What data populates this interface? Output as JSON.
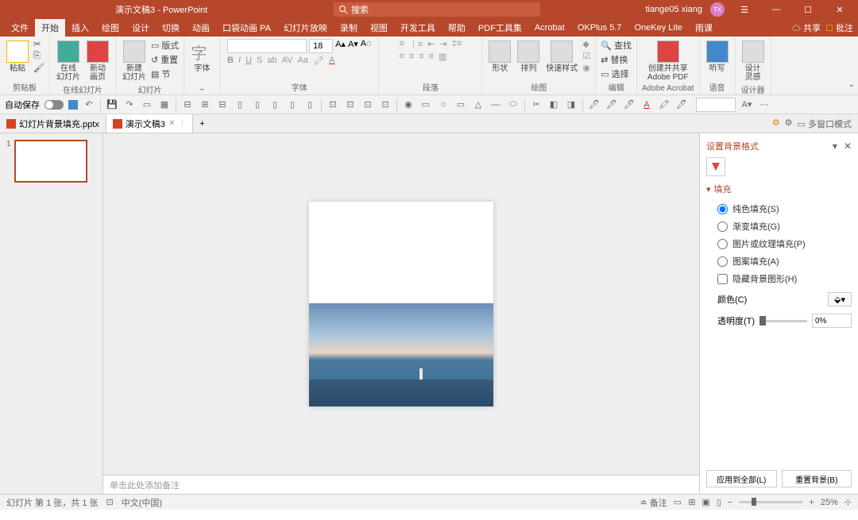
{
  "title": {
    "doc": "演示文稿3 - PowerPoint",
    "search": "搜索",
    "user": "tiange05 xiang",
    "avatar": "TX"
  },
  "menu": {
    "items": [
      "文件",
      "开始",
      "插入",
      "绘图",
      "设计",
      "切换",
      "动画",
      "口袋动画 PA",
      "幻灯片放映",
      "录制",
      "视图",
      "开发工具",
      "帮助",
      "PDF工具集",
      "Acrobat",
      "OKPlus 5.7",
      "OneKey Lite",
      "雨课"
    ],
    "active": 1,
    "share": "共享",
    "comment": "批注"
  },
  "ribbon": {
    "g1": {
      "paste": "粘贴",
      "label": "剪贴板"
    },
    "g2": {
      "online": "在线\n幻灯片",
      "newpage": "新动\n画页",
      "label": "在线幻灯片"
    },
    "g3": {
      "newslide": "新建\n幻灯片",
      "layout": "版式",
      "reset": "重置",
      "section": "节",
      "label": "幻灯片"
    },
    "g4": {
      "font": "字体",
      "label": "字体",
      "fontsize": "18"
    },
    "g5": {
      "label": "段落"
    },
    "g6": {
      "shape": "形状",
      "arrange": "排列",
      "quick": "快速样式",
      "label": "绘图"
    },
    "g7": {
      "find": "查找",
      "replace": "替换",
      "select": "选择",
      "label": "编辑"
    },
    "g8": {
      "adobe": "创建并共享\nAdobe PDF",
      "label": "Adobe Acrobat"
    },
    "g9": {
      "dict": "听写",
      "label": "语音"
    },
    "g10": {
      "design": "设计\n灵感",
      "label": "设计器"
    }
  },
  "qat": {
    "autosave": "自动保存"
  },
  "doctabs": {
    "t1": "幻灯片背景填充.pptx",
    "t2": "演示文稿3",
    "multi": "多窗口模式"
  },
  "thumb": {
    "num": "1"
  },
  "notes": "单击此处添加备注",
  "pane": {
    "title": "设置背景格式",
    "section": "填充",
    "o1": "纯色填充(S)",
    "o2": "渐变填充(G)",
    "o3": "图片或纹理填充(P)",
    "o4": "图案填充(A)",
    "o5": "隐藏背景图形(H)",
    "color": "颜色(C)",
    "trans": "透明度(T)",
    "transval": "0%",
    "apply": "应用到全部(L)",
    "reset": "重置背景(B)"
  },
  "status": {
    "slide": "幻灯片 第 1 张，共 1 张",
    "lang": "中文(中国)",
    "notes": "备注",
    "zoom": "25%"
  }
}
